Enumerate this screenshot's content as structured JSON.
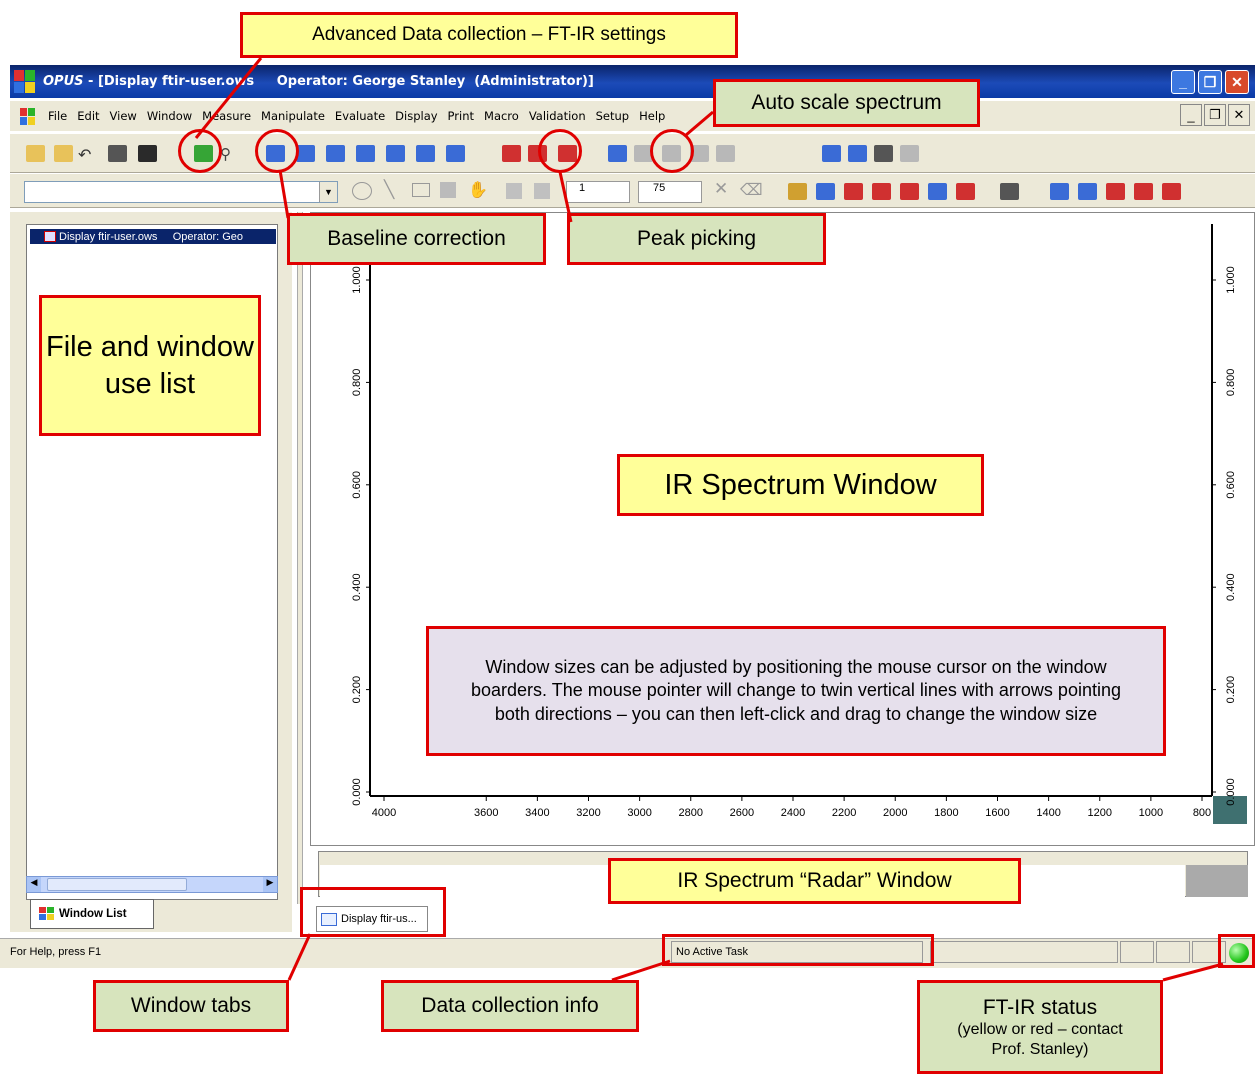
{
  "app": {
    "title_app": "OPUS",
    "title_rest": " - [Display ftir-user.ows     Operator: George Stanley  (Administrator)]",
    "window_buttons": [
      "_",
      "❐",
      "✕"
    ]
  },
  "menu": {
    "items": [
      "File",
      "Edit",
      "View",
      "Window",
      "Measure",
      "Manipulate",
      "Evaluate",
      "Display",
      "Print",
      "Macro",
      "Validation",
      "Setup",
      "Help"
    ],
    "mdi_buttons": [
      "_",
      "❐",
      "✕"
    ]
  },
  "toolbar2": {
    "combo_value": "",
    "spin1_value": "1",
    "spin2_value": "75"
  },
  "left_panel": {
    "list_item": "Display ftir-user.ows     Operator: Geo",
    "tab_label": "Window List"
  },
  "document_tab": "Display ftir-us...",
  "status": {
    "help_text": "For Help, press F1",
    "task_text": "No Active Task",
    "led_color": "#22c41a"
  },
  "chart_data": {
    "type": "line",
    "x_ticks": [
      "4000",
      "3600",
      "3400",
      "3200",
      "3000",
      "2800",
      "2600",
      "2400",
      "2200",
      "2000",
      "1800",
      "1600",
      "1400",
      "1200",
      "1000",
      "800"
    ],
    "y_ticks": [
      "0.000",
      "0.200",
      "0.400",
      "0.600",
      "0.800",
      "1.000"
    ],
    "series": [],
    "xlim": [
      4000,
      800
    ],
    "ylim": [
      0,
      1
    ]
  },
  "callouts": {
    "advanced": "Advanced Data collection – FT-IR settings",
    "autoscale": "Auto scale spectrum",
    "baseline": "Baseline correction",
    "peak": "Peak picking",
    "file_list": "File and window use list",
    "ir_window": "IR Spectrum Window",
    "window_note": "Window sizes can be adjusted by positioning the mouse cursor on the window boarders. The mouse pointer will change to twin vertical lines with arrows pointing both directions – you can then left-click and drag to change the window size",
    "radar": "IR Spectrum “Radar” Window",
    "window_tabs": "Window tabs",
    "data_info": "Data collection info",
    "ftir_status_title": "FT-IR status",
    "ftir_status_note": "(yellow or red – contact Prof. Stanley)"
  }
}
